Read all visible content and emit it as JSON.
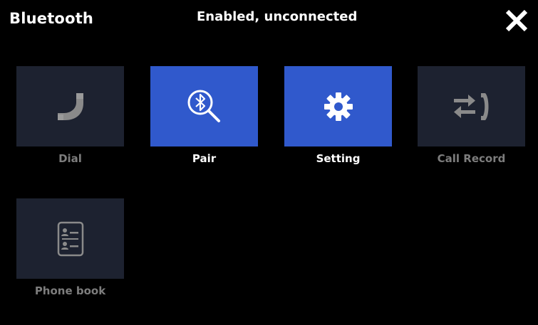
{
  "header": {
    "title": "Bluetooth",
    "status": "Enabled, unconnected",
    "close_icon": "close-icon"
  },
  "colors": {
    "background": "#000000",
    "tile_inactive": "#1d2230",
    "tile_active": "#3059cc",
    "label_inactive": "#7d7d7d",
    "label_active": "#ffffff",
    "icon_inactive": "#8a8a8a"
  },
  "tiles": [
    {
      "label": "Dial",
      "icon": "phone-icon",
      "active": false
    },
    {
      "label": "Pair",
      "icon": "bluetooth-search-icon",
      "active": true
    },
    {
      "label": "Setting",
      "icon": "gear-icon",
      "active": true
    },
    {
      "label": "Call Record",
      "icon": "call-transfer-icon",
      "active": false
    },
    {
      "label": "Phone book",
      "icon": "contacts-icon",
      "active": false
    }
  ]
}
